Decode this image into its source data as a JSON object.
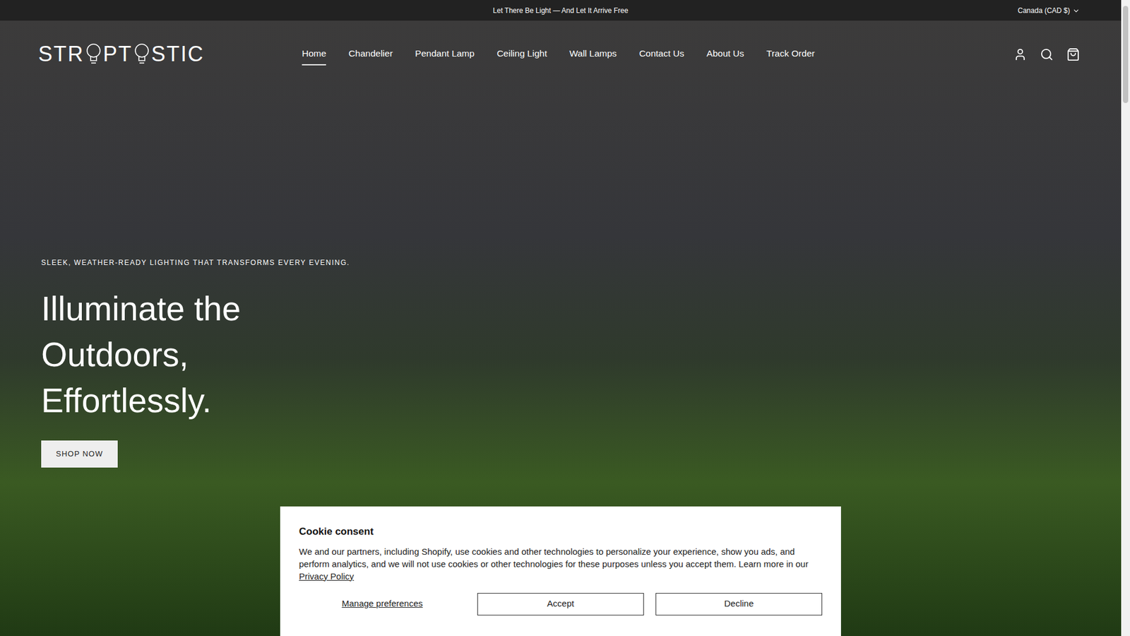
{
  "announcement": "Let There Be Light — And Let It Arrive Free",
  "currency": {
    "label": "Canada (CAD $)"
  },
  "logo": {
    "parts": [
      "STR",
      "PT",
      "STIC"
    ]
  },
  "nav": [
    {
      "label": "Home",
      "selected": true
    },
    {
      "label": "Chandelier",
      "selected": false
    },
    {
      "label": "Pendant Lamp",
      "selected": false
    },
    {
      "label": "Ceiling Light",
      "selected": false
    },
    {
      "label": "Wall Lamps",
      "selected": false
    },
    {
      "label": "Contact Us",
      "selected": false
    },
    {
      "label": "About Us",
      "selected": false
    },
    {
      "label": "Track Order",
      "selected": false
    }
  ],
  "hero": {
    "eyebrow": "SLEEK, WEATHER-READY LIGHTING THAT TRANSFORMS EVERY EVENING.",
    "heading_lines": [
      "Illuminate the",
      "Outdoors,",
      "Effortlessly."
    ],
    "button": "SHOP NOW"
  },
  "cookie": {
    "title": "Cookie consent",
    "body": "We and our partners, including Shopify, use cookies and other technologies to personalize your experience, show you ads, and perform analytics, and we will not use cookies or other technologies for these purposes unless you accept them. Learn more in our ",
    "link": "Privacy Policy",
    "buttons": [
      {
        "label": "Manage preferences",
        "kind": "link"
      },
      {
        "label": "Accept",
        "kind": "outline"
      },
      {
        "label": "Decline",
        "kind": "outline"
      }
    ]
  }
}
